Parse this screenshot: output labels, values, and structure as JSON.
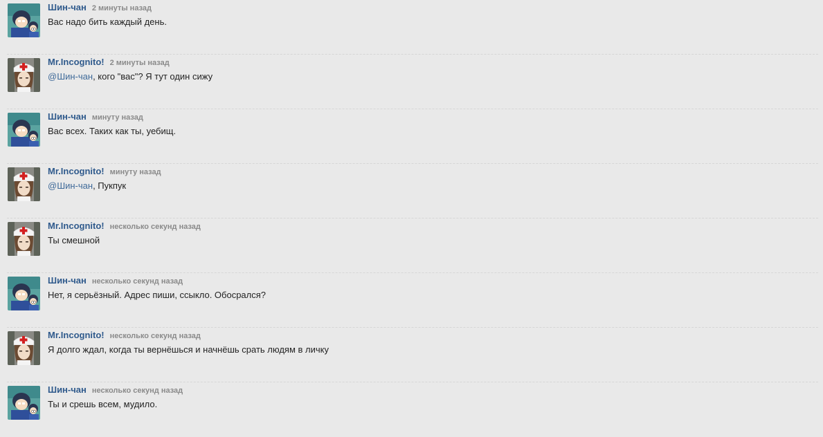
{
  "comments": [
    {
      "user": "Шин-чан",
      "avatar": "conan-avatar",
      "time": "2 минуты назад",
      "mention": "",
      "text": "Вас надо бить каждый день."
    },
    {
      "user": "Mr.Incognito!",
      "avatar": "nurse-avatar",
      "time": "2 минуты назад",
      "mention": "@Шин-чан",
      "text": ", кого \"вас\"? Я тут один сижу"
    },
    {
      "user": "Шин-чан",
      "avatar": "conan-avatar",
      "time": "минуту назад",
      "mention": "",
      "text": "Вас всех. Таких как ты, уебищ."
    },
    {
      "user": "Mr.Incognito!",
      "avatar": "nurse-avatar",
      "time": "минуту назад",
      "mention": "@Шин-чан",
      "text": ", Пукпук"
    },
    {
      "user": "Mr.Incognito!",
      "avatar": "nurse-avatar",
      "time": "несколько секунд назад",
      "mention": "",
      "text": "Ты смешной"
    },
    {
      "user": "Шин-чан",
      "avatar": "conan-avatar",
      "time": "несколько секунд назад",
      "mention": "",
      "text": "Нет, я серьёзный. Адрес пиши, ссыкло. Обосрался?"
    },
    {
      "user": "Mr.Incognito!",
      "avatar": "nurse-avatar",
      "time": "несколько секунд назад",
      "mention": "",
      "text": "Я долго ждал, когда ты вернёшься и начнёшь срать людям в личку"
    },
    {
      "user": "Шин-чан",
      "avatar": "conan-avatar",
      "time": "несколько секунд назад",
      "mention": "",
      "text": "Ты и срешь всем, мудило."
    }
  ],
  "colors": {
    "background": "#e9e9e9",
    "username": "#2f5a8c",
    "mention": "#3f6a99",
    "time": "#8a8a8a"
  }
}
